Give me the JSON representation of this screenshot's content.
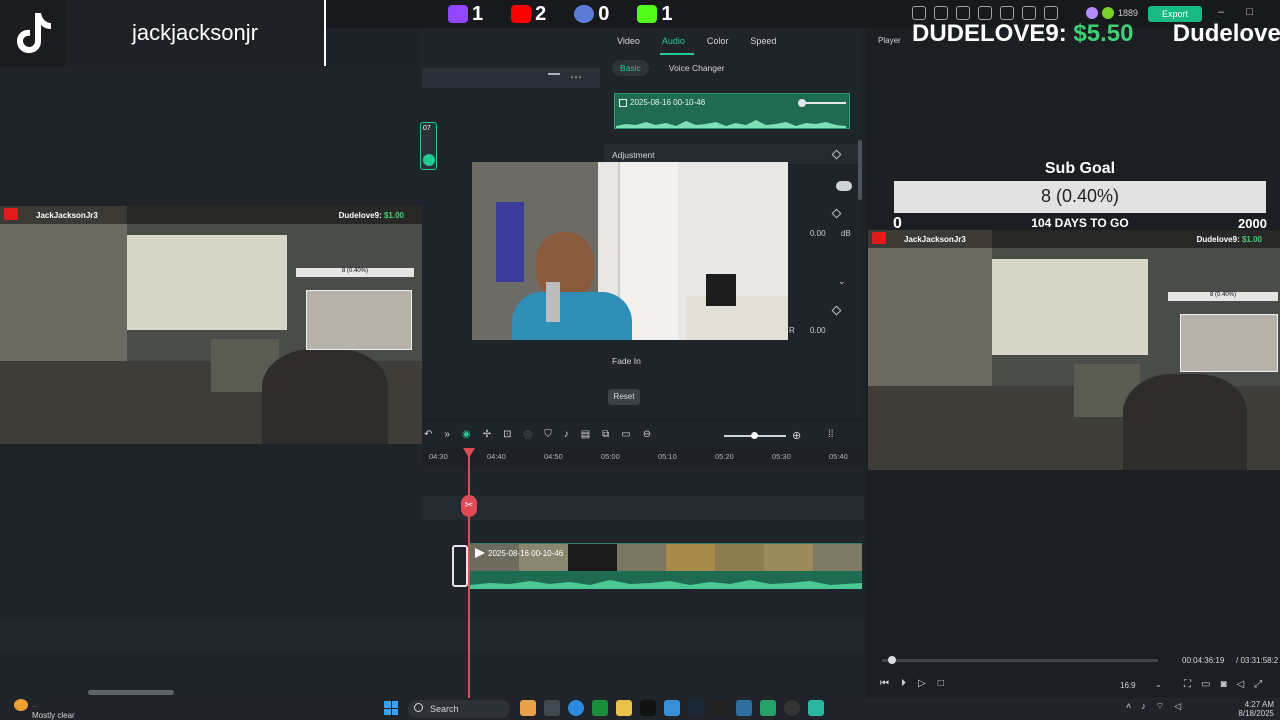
{
  "tiktok": {
    "username": "jackjacksonjr"
  },
  "platforms": [
    {
      "name": "twitch-icon",
      "count": "1",
      "color": "#9146ff"
    },
    {
      "name": "youtube-icon",
      "count": "2",
      "color": "#ff0000"
    },
    {
      "name": "kick-small-icon",
      "count": "0",
      "color": "#5b7bd5"
    },
    {
      "name": "kick-icon",
      "count": "1",
      "color": "#53fc18"
    }
  ],
  "topbar": {
    "coins": "1889",
    "export_label": "Export"
  },
  "properties": {
    "tabs": [
      "Video",
      "Audio",
      "Color",
      "Speed"
    ],
    "active_tab": "Audio",
    "subtabs": [
      "Basic",
      "Voice Changer"
    ],
    "clip_name": "2025-08-16 00-10-46",
    "adjustment_label": "Adjustment",
    "db_value": "0.00",
    "db_unit": "dB",
    "r_label": "R",
    "r_value": "0.00",
    "fade_in_label": "Fade In",
    "reset_label": "Reset"
  },
  "search_partial": {
    "left_snippet": "07"
  },
  "overlay": {
    "dudelove_name": "DUDELOVE9:",
    "dudelove_amount": "$5.50",
    "dudelove_repeat": "Dudelove",
    "player_label": "Player",
    "subgoal_title": "Sub Goal",
    "subgoal_value": "8 (0.40%)",
    "subgoal_min": "0",
    "subgoal_days": "104 DAYS TO GO",
    "subgoal_max": "2000"
  },
  "game_left": {
    "channel": "JackJacksonJr3",
    "donor": "Dudelove9:",
    "amount": "$1.00",
    "sub": "8 (0.40%)"
  },
  "game_right": {
    "channel": "JackJacksonJr3",
    "donor": "Dudelove9:",
    "amount": "$1.00",
    "sub": "8 (0.40%)"
  },
  "timeline": {
    "ticks": [
      "04:30",
      "04:40",
      "04:50",
      "05:00",
      "05:10",
      "05:20",
      "05:30",
      "05:40"
    ],
    "clip_label": "2025-08-16 00-10-46"
  },
  "player": {
    "current_time": "00:04:36:19",
    "total_time": "/ 03:31:58:2",
    "progress_fraction": 0.02,
    "aspect": "16:9"
  },
  "taskbar": {
    "weather_temp": "...",
    "weather": "Mostly clear",
    "search": "Search",
    "time": "4:27 AM",
    "date": "8/18/2025"
  }
}
